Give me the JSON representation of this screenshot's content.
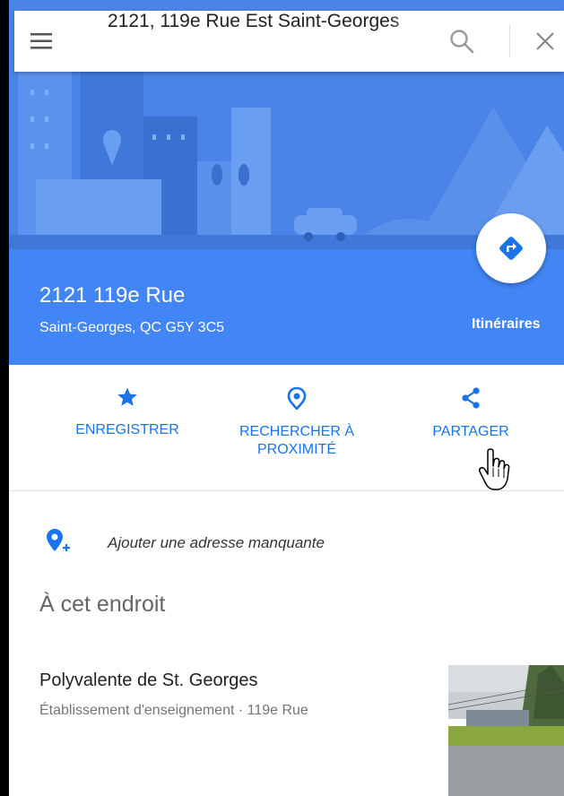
{
  "search": {
    "value": "2121, 119e Rue Est Saint-Georges",
    "menu_icon": "hamburger-menu-icon",
    "search_icon": "search-icon",
    "close_icon": "close-icon"
  },
  "place": {
    "title": "2121 119e Rue",
    "subtitle": "Saint-Georges, QC G5Y 3C5",
    "directions_label": "Itinéraires",
    "directions_icon": "directions-arrow-icon"
  },
  "actions": [
    {
      "label_line1": "ENREGISTRER",
      "label_line2": "",
      "icon": "star-icon"
    },
    {
      "label_line1": "RECHERCHER À",
      "label_line2": "PROXIMITÉ",
      "icon": "nearby-pin-icon"
    },
    {
      "label_line1": "PARTAGER",
      "label_line2": "",
      "icon": "share-icon"
    }
  ],
  "add_address": {
    "text": "Ajouter une adresse manquante",
    "icon": "add-location-icon"
  },
  "section_title": "À cet endroit",
  "poi": {
    "name": "Polyvalente de St. Georges",
    "meta": "Établissement d'enseignement · 119e Rue"
  },
  "colors": {
    "header_blue": "#4285f4",
    "accent_blue": "#1a73e8",
    "hero_bg": "#4a84e9"
  }
}
